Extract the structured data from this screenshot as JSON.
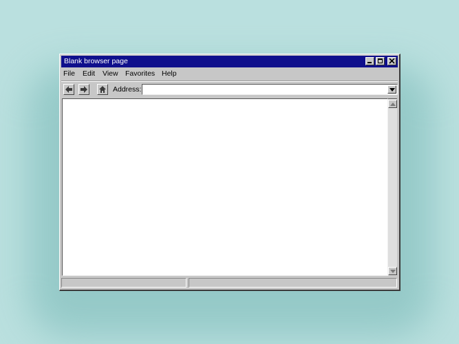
{
  "window": {
    "title": "Blank browser page"
  },
  "menu": {
    "items": [
      "File",
      "Edit",
      "View",
      "Favorites",
      "Help"
    ]
  },
  "toolbar": {
    "address_label": "Address:",
    "address_value": ""
  },
  "status": {
    "left": "",
    "right": ""
  },
  "colors": {
    "background": "#bae0df",
    "titlebar": "#0f0f8c",
    "chrome": "#c7c7c7"
  },
  "icons": [
    "minimize-icon",
    "maximize-icon",
    "close-icon",
    "back-arrow-icon",
    "forward-arrow-icon",
    "home-icon",
    "dropdown-arrow-icon",
    "scroll-up-icon",
    "scroll-down-icon"
  ]
}
